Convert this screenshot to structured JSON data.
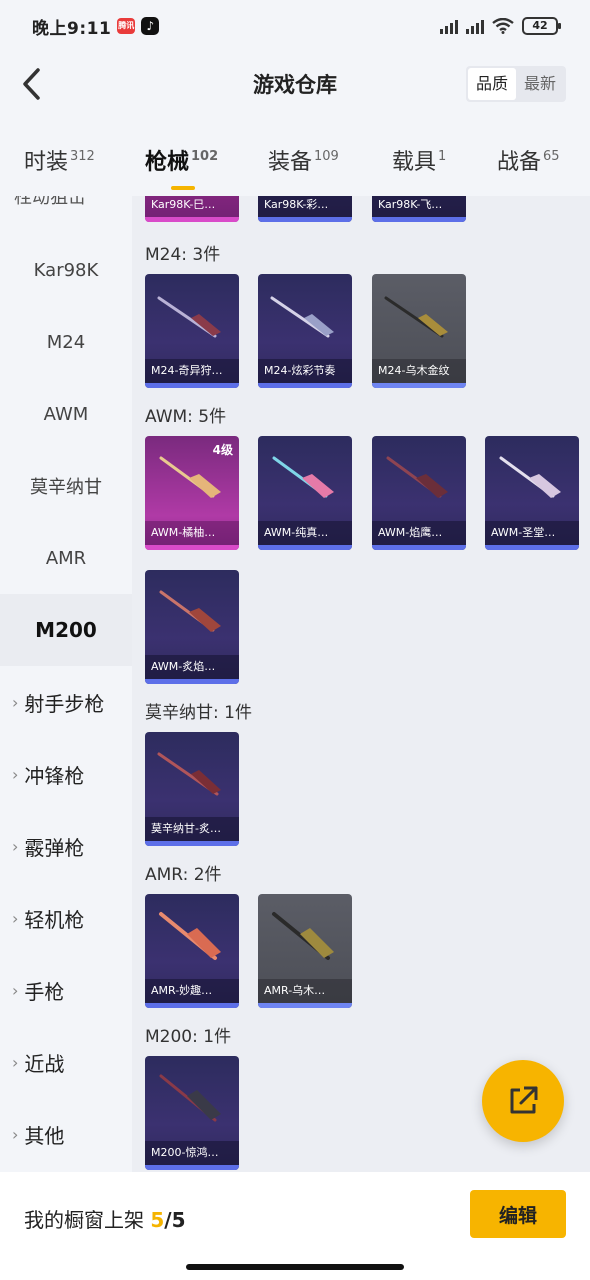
{
  "status_bar": {
    "time": "晚上9:11",
    "badge": "腾讯",
    "battery": "42"
  },
  "nav": {
    "title": "游戏仓库",
    "sort_options": [
      "品质",
      "最新"
    ],
    "sort_selected": "品质"
  },
  "tabs": [
    {
      "label": "时装",
      "count": "312"
    },
    {
      "label": "枪械",
      "count": "102",
      "active": true
    },
    {
      "label": "装备",
      "count": "109"
    },
    {
      "label": "载具",
      "count": "1"
    },
    {
      "label": "战备",
      "count": "65"
    }
  ],
  "sidebar": {
    "cut_item": "栓动狙击",
    "sub_items": [
      "Kar98K",
      "M24",
      "AWM",
      "莫辛纳甘",
      "AMR",
      "M200"
    ],
    "active_item": "M200",
    "groups": [
      "射手步枪",
      "冲锋枪",
      "霰弹枪",
      "轻机枪",
      "手枪",
      "近战",
      "其他"
    ]
  },
  "content": {
    "top_row_labels": [
      "Kar98K-巳…",
      "Kar98K-彩…",
      "Kar98K-飞…"
    ],
    "sections": [
      {
        "title": "M24: 3件",
        "items": [
          "M24-奇异狩…",
          "M24-炫彩节奏",
          "M24-乌木金纹"
        ]
      },
      {
        "title": "AWM: 5件",
        "items": [
          "AWM-橘柚…",
          "AWM-纯真…",
          "AWM-焰鹰…",
          "AWM-圣堂…",
          "AWM-炙焰…"
        ],
        "first_level": "4级"
      },
      {
        "title": "莫辛纳甘: 1件",
        "items": [
          "莫辛纳甘-炙…"
        ]
      },
      {
        "title": "AMR: 2件",
        "items": [
          "AMR-妙趣…",
          "AMR-乌木…"
        ]
      },
      {
        "title": "M200: 1件",
        "items": [
          "M200-惊鸿…"
        ]
      }
    ]
  },
  "bottom": {
    "text": "我的橱窗上架",
    "shelved": "5",
    "total": "/5",
    "edit_label": "编辑"
  },
  "colors": {
    "accent": "#f7b400",
    "card_blue": "#2d2c5e",
    "card_pink": "#b03aa6",
    "card_gray": "#55575f"
  }
}
